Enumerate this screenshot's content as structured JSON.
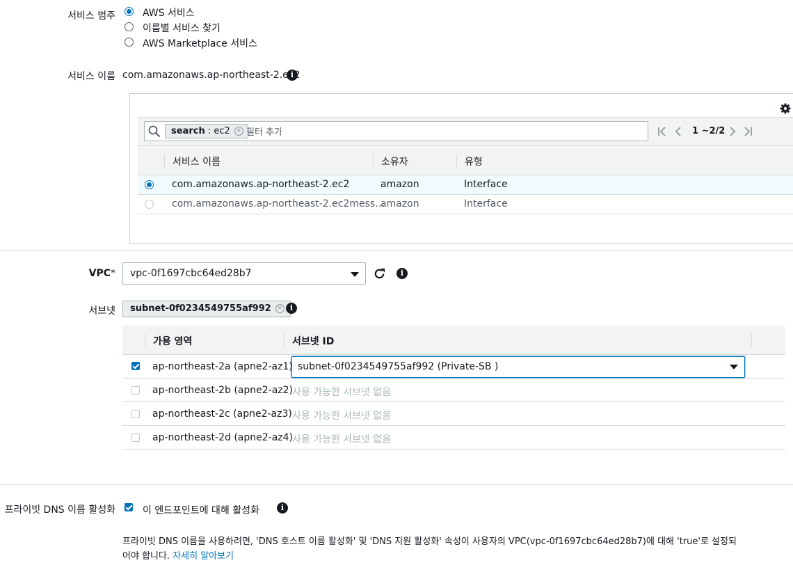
{
  "service_category": {
    "label": "서비스 범주",
    "options": [
      "AWS 서비스",
      "이름별 서비스 찾기",
      "AWS Marketplace 서비스"
    ],
    "selected": 0
  },
  "service_name": {
    "label": "서비스 이름",
    "value": "com.amazonaws.ap-northeast-2.ec2"
  },
  "service_table": {
    "filter_token_key": "search",
    "filter_token_value": " : ec2",
    "filter_placeholder": "필터 추가",
    "pagination": "1 ~2/2",
    "columns": [
      "서비스 이름",
      "소유자",
      "유형"
    ],
    "rows": [
      {
        "name": "com.amazonaws.ap-northeast-2.ec2",
        "owner": "amazon",
        "type": "Interface",
        "selected": true
      },
      {
        "name": "com.amazonaws.ap-northeast-2.ec2mess…",
        "owner": "amazon",
        "type": "Interface",
        "selected": false
      }
    ]
  },
  "vpc": {
    "label": "VPC",
    "required_mark": "*",
    "value": "vpc-0f1697cbc64ed28b7"
  },
  "subnets": {
    "label": "서브넷",
    "token": "subnet-0f0234549755af992",
    "columns": [
      "가용 영역",
      "서브넷 ID"
    ],
    "rows": [
      {
        "az": "ap-northeast-2a (apne2-az1)",
        "checked": true,
        "subnet": "subnet-0f0234549755af992 (Private-SB )"
      },
      {
        "az": "ap-northeast-2b (apne2-az2)",
        "checked": false,
        "subnet": "사용 가능한 서브넷 없음"
      },
      {
        "az": "ap-northeast-2c (apne2-az3)",
        "checked": false,
        "subnet": "사용 가능한 서브넷 없음"
      },
      {
        "az": "ap-northeast-2d (apne2-az4)",
        "checked": false,
        "subnet": "사용 가능한 서브넷 없음"
      }
    ]
  },
  "private_dns": {
    "label": "프라이빗 DNS 이름 활성화",
    "checkbox_label": "이 엔드포인트에 대해 활성화",
    "checked": true,
    "help_line1": "프라이빗 DNS 이름을 사용하려면, 'DNS 호스트 이름 활성화' 및 'DNS 지원 활성화' 속성이 사용자의 VPC(vpc-0f1697cbc64ed28b7)에 대해 'true'로 설정되",
    "help_line2": "어야 합니다. ",
    "learn_more": "자세히 알아보기"
  },
  "colors": {
    "accent": "#0073bb",
    "border": "#aab7b8",
    "header_bg": "#f2f3f3",
    "selected_row": "#f1faff"
  },
  "icons": [
    "info-icon",
    "search-icon",
    "gear-icon",
    "refresh-icon",
    "chevron-down-icon",
    "first-page-icon",
    "prev-page-icon",
    "next-page-icon",
    "last-page-icon",
    "close-icon"
  ]
}
